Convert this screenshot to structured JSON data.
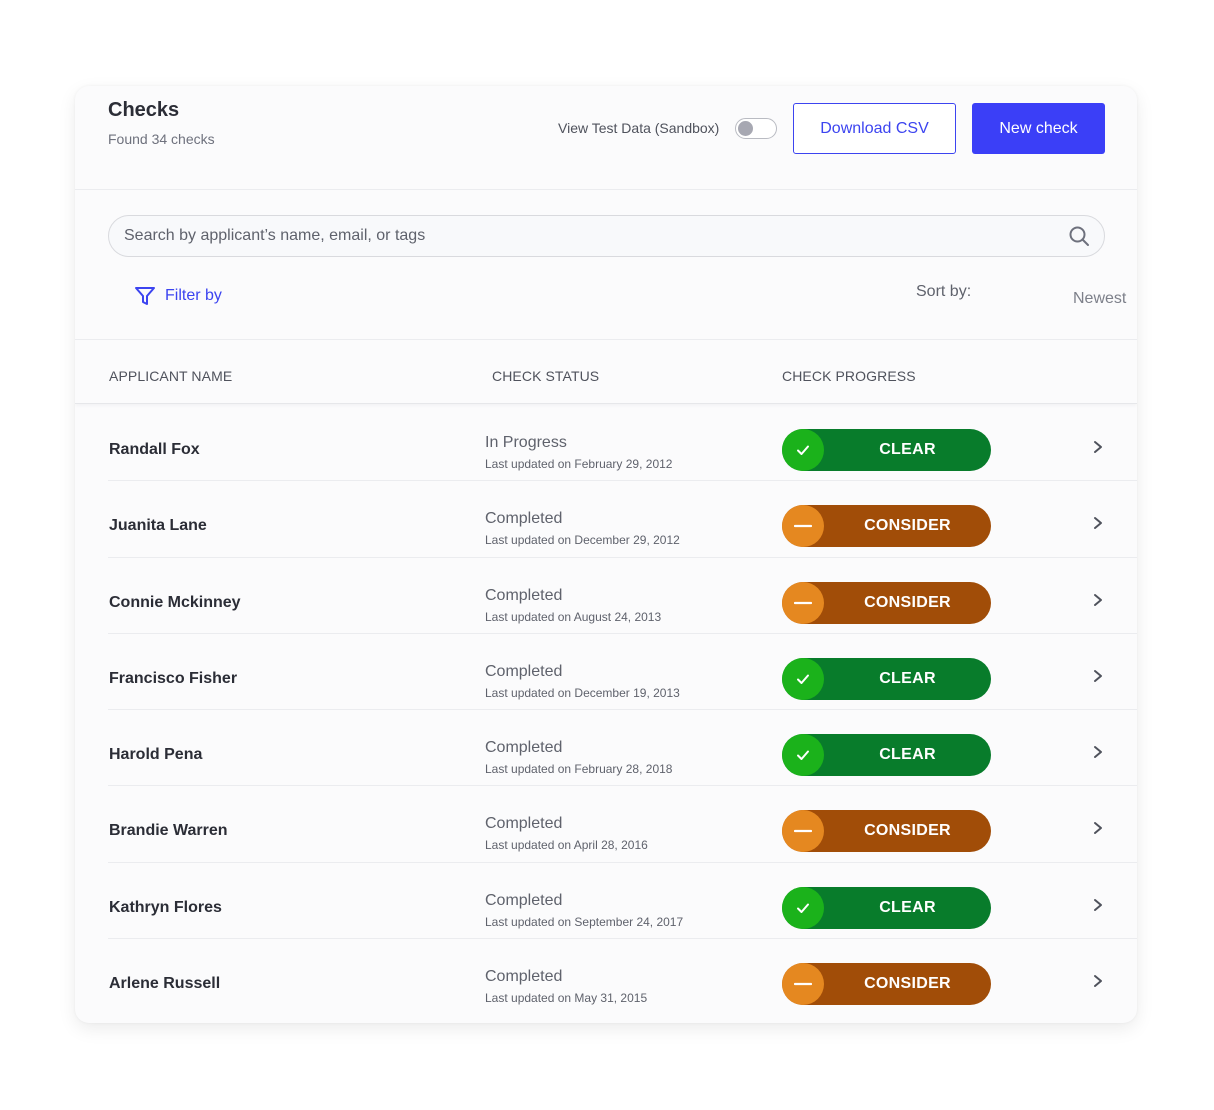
{
  "header": {
    "title": "Checks",
    "subtitle": "Found 34 checks",
    "sandbox_label": "View Test Data (Sandbox)",
    "sandbox_enabled": false,
    "download_label": "Download CSV",
    "new_check_label": "New check"
  },
  "search": {
    "placeholder": "Search by applicant’s name, email, or tags",
    "value": "",
    "icon": "search-icon"
  },
  "filter": {
    "label": "Filter by",
    "icon": "filter-funnel-icon"
  },
  "sort": {
    "label": "Sort by:",
    "value": "Newest"
  },
  "table": {
    "columns": [
      "APPLICANT NAME",
      "CHECK STATUS",
      "CHECK PROGRESS"
    ],
    "rows": [
      {
        "name": "Randall Fox",
        "status": "In Progress",
        "updated": "Last updated on February 29, 2012",
        "result": "CLEAR",
        "result_type": "clear"
      },
      {
        "name": "Juanita Lane",
        "status": "Completed",
        "updated": "Last updated on December 29, 2012",
        "result": "CONSIDER",
        "result_type": "consider"
      },
      {
        "name": "Connie Mckinney",
        "status": "Completed",
        "updated": "Last updated on August 24, 2013",
        "result": "CONSIDER",
        "result_type": "consider"
      },
      {
        "name": "Francisco Fisher",
        "status": "Completed",
        "updated": "Last updated on December 19, 2013",
        "result": "CLEAR",
        "result_type": "clear"
      },
      {
        "name": "Harold Pena",
        "status": "Completed",
        "updated": "Last updated on February 28, 2018",
        "result": "CLEAR",
        "result_type": "clear"
      },
      {
        "name": "Brandie Warren",
        "status": "Completed",
        "updated": "Last updated on April 28, 2016",
        "result": "CONSIDER",
        "result_type": "consider"
      },
      {
        "name": "Kathryn Flores",
        "status": "Completed",
        "updated": "Last updated on September 24, 2017",
        "result": "CLEAR",
        "result_type": "clear"
      },
      {
        "name": "Arlene Russell",
        "status": "Completed",
        "updated": "Last updated on May 31, 2015",
        "result": "CONSIDER",
        "result_type": "consider"
      }
    ]
  },
  "colors": {
    "accent": "#3b3ff7",
    "clear_bg": "#087c2b",
    "clear_icon": "#1bb21b",
    "consider_bg": "#a14d08",
    "consider_icon": "#e58820"
  }
}
